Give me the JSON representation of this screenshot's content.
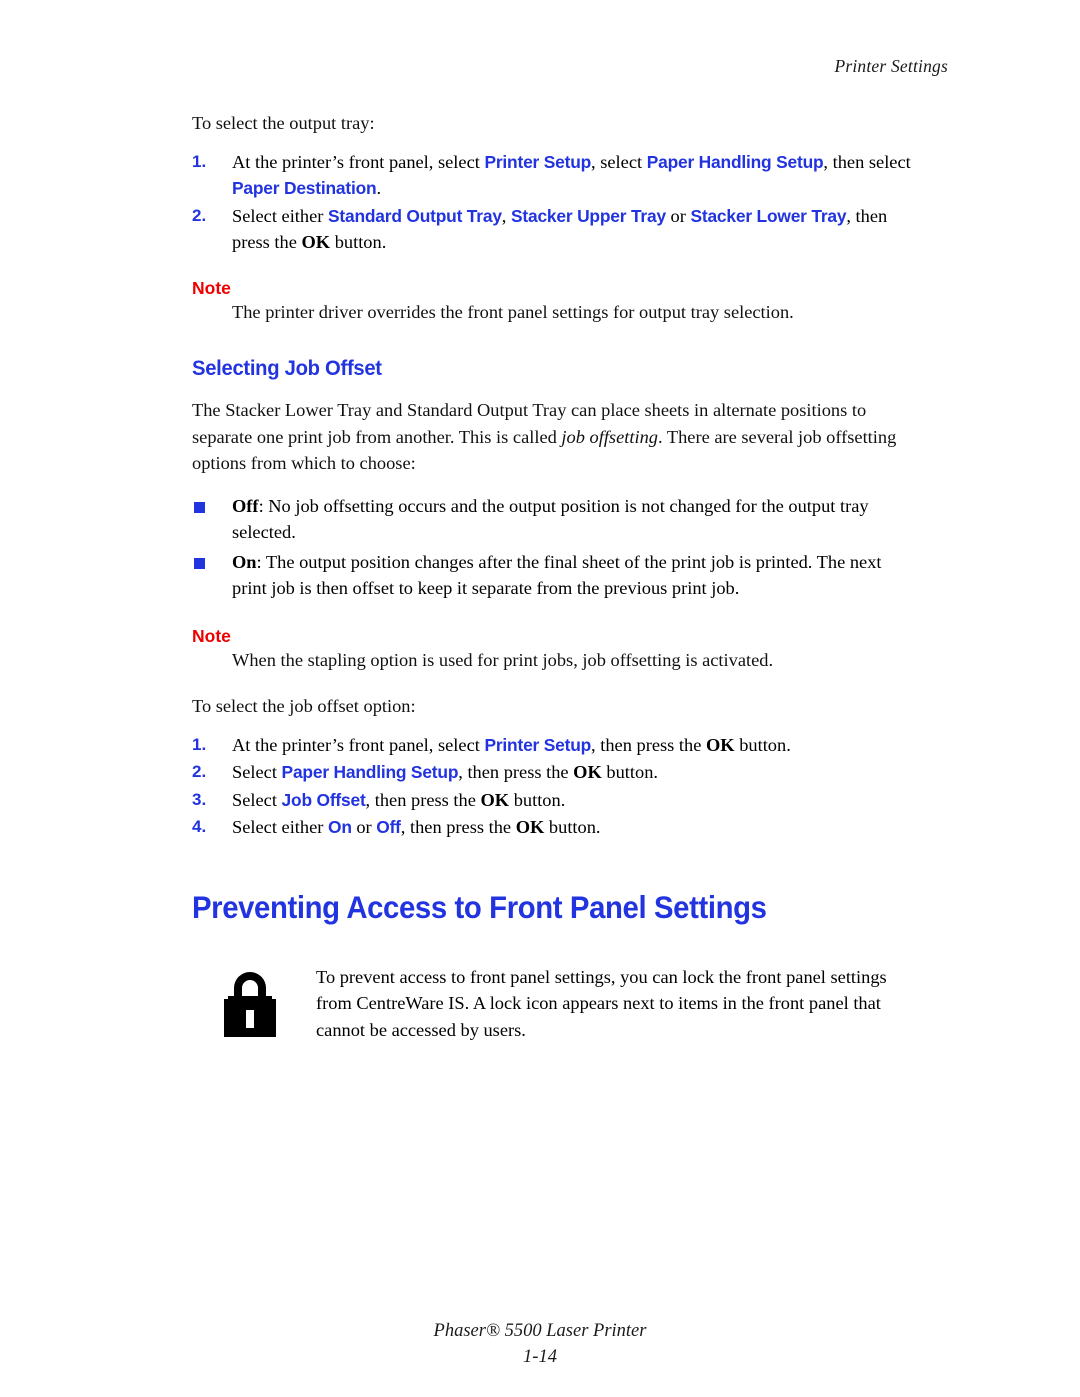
{
  "colors": {
    "link_blue": "#2233e0",
    "note_red": "#ee0000",
    "text_black": "#111111"
  },
  "header": {
    "running_head": "Printer Settings"
  },
  "section_output_tray": {
    "lead_in": "To select the output tray:",
    "steps": [
      {
        "num": "1.",
        "part1": "At the printer’s front panel, select ",
        "ui1": "Printer Setup",
        "part2": ", select ",
        "ui2": "Paper Handling Setup",
        "part3": ", then select ",
        "ui3": "Paper Destination",
        "part4": "."
      },
      {
        "num": "2.",
        "part1": "Select either ",
        "ui1": "Standard Output Tray",
        "part2": ", ",
        "ui2": "Stacker Upper Tray",
        "part3": " or ",
        "ui3": "Stacker Lower Tray",
        "part4": ", then press the ",
        "kbd": "OK",
        "part5": " button."
      }
    ]
  },
  "note_one": {
    "label": "Note",
    "text": "The printer driver overrides the front panel settings for output tray selection."
  },
  "section_job_offset": {
    "heading": "Selecting Job Offset",
    "paragraph_part1": "The Stacker Lower Tray and Standard Output Tray can place sheets in alternate positions to separate one print job from another. This is called ",
    "paragraph_italic": "job offsetting",
    "paragraph_part2": ". There are several job offsetting options from which to choose:",
    "bullets": [
      {
        "term": "Off",
        "text": ": No job offsetting occurs and the output position is not changed for the output tray selected."
      },
      {
        "term": "On",
        "text": ": The output position changes after the final sheet of the print job is printed. The next print job is then offset to keep it separate from the previous print job."
      }
    ]
  },
  "note_two": {
    "label": "Note",
    "text": "When the stapling option is used for print jobs, job offsetting is activated."
  },
  "section_job_offset_steps": {
    "lead_in": "To select the job offset option:",
    "steps": [
      {
        "num": "1.",
        "part1": "At the printer’s front panel, select ",
        "ui1": "Printer Setup",
        "part2": ", then press the ",
        "kbd": "OK",
        "part3": " button."
      },
      {
        "num": "2.",
        "part1": "Select ",
        "ui1": "Paper Handling Setup",
        "part2": ", then press the ",
        "kbd": "OK",
        "part3": " button."
      },
      {
        "num": "3.",
        "part1": "Select ",
        "ui1": "Job Offset",
        "part2": ", then press the ",
        "kbd": "OK",
        "part3": " button."
      },
      {
        "num": "4.",
        "part1": "Select either ",
        "ui1": "On",
        "part2": " or ",
        "ui2": "Off",
        "part3": ", then press the ",
        "kbd": "OK",
        "part4": " button."
      }
    ]
  },
  "section_preventing_access": {
    "heading": "Preventing Access to Front Panel Settings",
    "icon": "lock-icon",
    "callout_text": "To prevent access to front panel settings, you can lock the front panel settings from CentreWare IS. A lock icon appears next to items in the front panel that cannot be accessed by users."
  },
  "footer": {
    "product": "Phaser® 5500 Laser Printer",
    "page_number": "1-14"
  }
}
